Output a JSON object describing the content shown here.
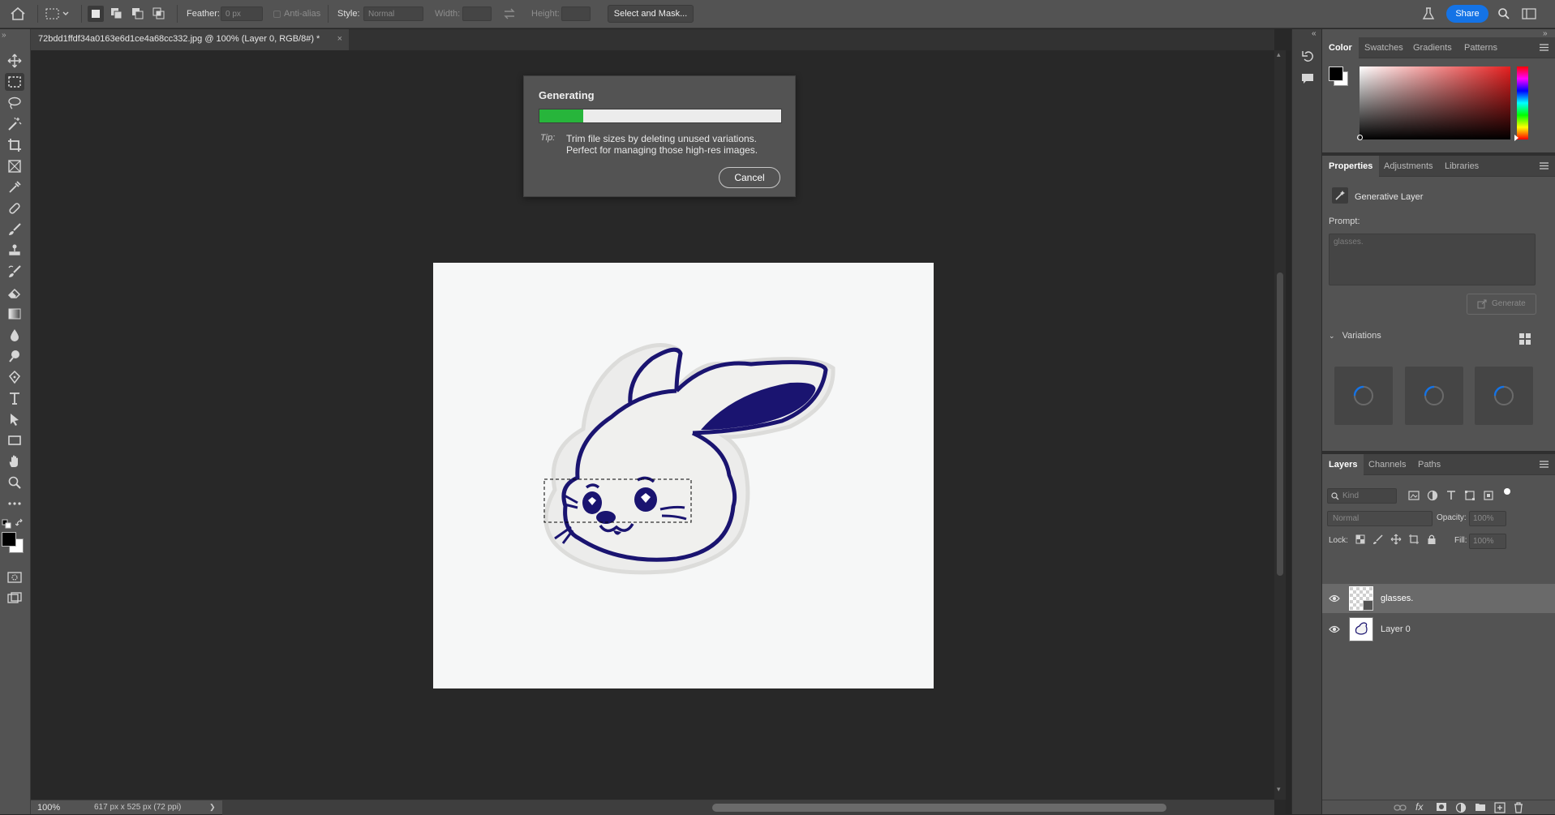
{
  "options_bar": {
    "feather_label": "Feather:",
    "feather_value": "0 px",
    "anti_alias_label": "Anti-alias",
    "style_label": "Style:",
    "style_value": "Normal",
    "width_label": "Width:",
    "height_label": "Height:",
    "select_mask_label": "Select and Mask...",
    "share_label": "Share"
  },
  "document_tab": {
    "title": "72bdd1ffdf34a0163e6d1ce4a68cc332.jpg @ 100% (Layer 0, RGB/8#) *",
    "close": "×"
  },
  "dialog": {
    "title": "Generating",
    "progress_fraction": 0.18,
    "tip_label": "Tip:",
    "tip_text": "Trim file sizes by deleting unused variations. Perfect for managing those high-res images.",
    "cancel_label": "Cancel"
  },
  "status_bar": {
    "zoom": "100%",
    "doc_info": "617 px x 525 px (72 ppi)",
    "arrow": "❯"
  },
  "color_panel": {
    "tabs": [
      "Color",
      "Swatches",
      "Gradients",
      "Patterns"
    ],
    "foreground": "#000000",
    "background": "#ffffff",
    "hue_color": "#e52020"
  },
  "properties_panel": {
    "tabs": [
      "Properties",
      "Adjustments",
      "Libraries"
    ],
    "layer_type": "Generative Layer",
    "prompt_label": "Prompt:",
    "prompt_value": "glasses.",
    "generate_label": "Generate",
    "variations_label": "Variations"
  },
  "layers_panel": {
    "tabs": [
      "Layers",
      "Channels",
      "Paths"
    ],
    "kind_placeholder": "Kind",
    "blend_mode": "Normal",
    "opacity_label": "Opacity:",
    "opacity_value": "100%",
    "lock_label": "Lock:",
    "fill_label": "Fill:",
    "fill_value": "100%",
    "layers": [
      {
        "name": "glasses.",
        "selected": true
      },
      {
        "name": "Layer 0",
        "selected": false
      }
    ]
  },
  "colors": {
    "accent_blue": "#1473e6",
    "progress_green": "#27b53b",
    "bunny_ink": "#1a1470"
  }
}
